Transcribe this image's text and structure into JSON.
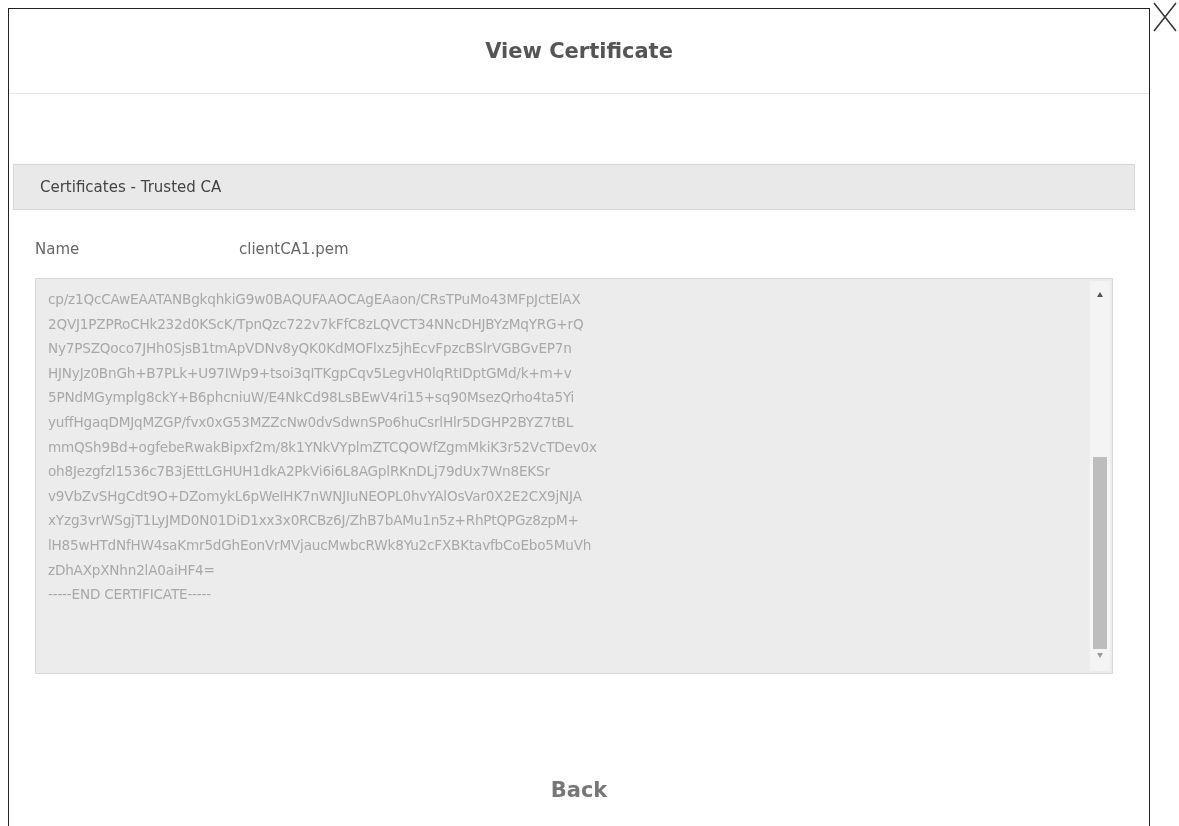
{
  "dialog": {
    "title": "View Certificate"
  },
  "section": {
    "title": "Certificates - Trusted CA"
  },
  "fields": [
    {
      "label": "Name",
      "value": "clientCA1.pem"
    }
  ],
  "certificate": {
    "lines": [
      "cp/z1QcCAwEAATANBgkqhkiG9w0BAQUFAAOCAgEAaon/CRsTPuMo43MFpJctElAX",
      "2QVJ1PZPRoCHk232d0KScK/TpnQzc722v7kFfC8zLQVCT34NNcDHJBYzMqYRG+rQ",
      "Ny7PSZQoco7JHh0SjsB1tmApVDNv8yQK0KdMOFlxz5jhEcvFpzcBSlrVGBGvEP7n",
      "HJNyJz0BnGh+B7PLk+U97IWp9+tsoi3qITKgpCqv5LegvH0lqRtIDptGMd/k+m+v",
      "5PNdMGymplg8ckY+B6phcniuW/E4NkCd98LsBEwV4ri15+sq90MsezQrho4ta5Yi",
      "yuffHgaqDMJqMZGP/fvx0xG53MZZcNw0dvSdwnSPo6huCsrlHlr5DGHP2BYZ7tBL",
      "mmQSh9Bd+ogfebeRwakBipxf2m/8k1YNkVYplmZTCQOWfZgmMkiK3r52VcTDev0x",
      "oh8Jezgfzl1536c7B3jEttLGHUH1dkA2PkVi6i6L8AGplRKnDLj79dUx7Wn8EKSr",
      "v9VbZvSHgCdt9O+DZomykL6pWeIHK7nWNJIuNEOPL0hvYAlOsVar0X2E2CX9jNJA",
      "xYzg3vrWSgjT1LyJMD0N01DiD1xx3x0RCBz6J/ZhB7bAMu1n5z+RhPtQPGz8zpM+",
      "lH85wHTdNfHW4saKmr5dGhEonVrMVjaucMwbcRWk8Yu2cFXBKtavfbCoEbo5MuVh",
      "zDhAXpXNhn2lA0aiHF4=",
      "-----END CERTIFICATE-----"
    ]
  },
  "buttons": [
    {
      "label": "Back"
    }
  ]
}
